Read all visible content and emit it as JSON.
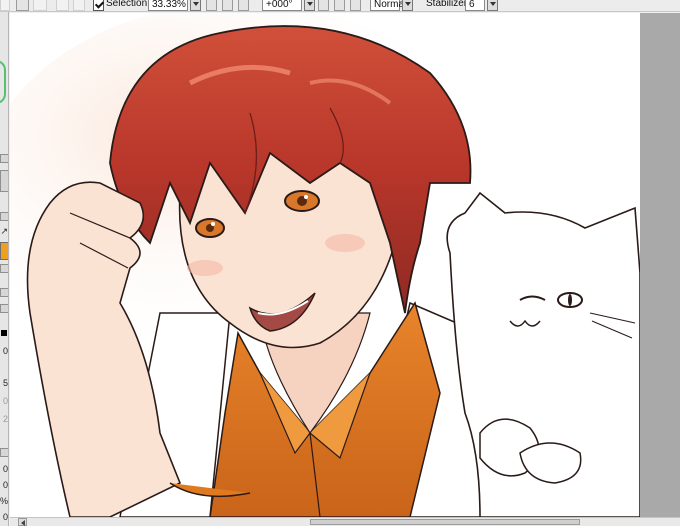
{
  "toolbar": {
    "selection_checked": true,
    "selection_label": "Selection",
    "zoom_value": "33.33%",
    "rotation_value": "+000°",
    "blend_mode_value": "Normal",
    "stabilizer_label": "Stabilizer",
    "stabilizer_value": "6",
    "icons": [
      "undo-icon",
      "redo-icon",
      "deselect-icon",
      "select-all-icon",
      "zoom-out-icon",
      "zoom-in-icon",
      "zoom-reset-icon",
      "rotate-left-icon",
      "rotate-right-icon",
      "rotate-reset-icon",
      "flip-icon"
    ]
  },
  "left_strip": {
    "swatch_color": "#f0a020",
    "numbers": [
      "0",
      "5",
      "0",
      "2",
      "0",
      "0",
      "0",
      "%"
    ],
    "dim_numbers": [
      "0",
      "2"
    ]
  },
  "canvas": {
    "hair_color": "#c0392b",
    "shirt_color": "#e07a1f",
    "skin_color": "#fbe3d3",
    "eye_color": "#d9772a",
    "line_color": "#2a1a18"
  },
  "colors": {
    "panel_gray": "#a9a9a9",
    "toolbar_bg": "#ececec"
  }
}
